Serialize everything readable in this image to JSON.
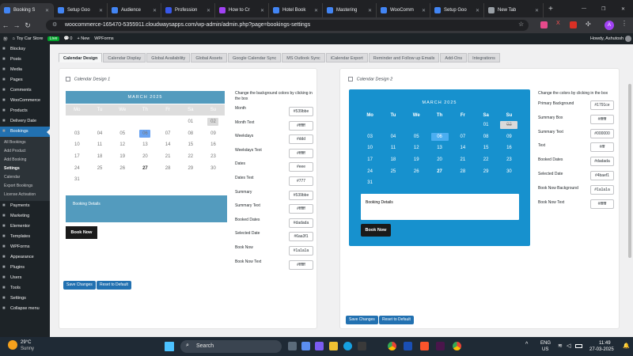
{
  "browser": {
    "tabs": [
      {
        "title": "Booking S",
        "color": "#4285f4",
        "active": true
      },
      {
        "title": "Setup Goo",
        "color": "#4285f4"
      },
      {
        "title": "Audience",
        "color": "#4285f4"
      },
      {
        "title": "Profession",
        "color": "#3858e9"
      },
      {
        "title": "How to Cr",
        "color": "#a142f4"
      },
      {
        "title": "Hotel Book",
        "color": "#4285f4"
      },
      {
        "title": "Mastering",
        "color": "#4285f4"
      },
      {
        "title": "WooComm",
        "color": "#4285f4"
      },
      {
        "title": "Setup Goo",
        "color": "#4285f4"
      },
      {
        "title": "New Tab",
        "color": "#9aa0a6"
      }
    ],
    "url": "woocommerce-165470-5355911.cloudwaysapps.com/wp-admin/admin.php?page=bookings-settings",
    "profile_initial": "A"
  },
  "adminbar": {
    "site": "Toy Car Store",
    "live": "Live",
    "comments": "0",
    "new": "+ New",
    "wpforms": "WPForms",
    "howdy": "Howdy, Ashutosh"
  },
  "sidebar": {
    "items_top": [
      {
        "label": "Blocksy",
        "icon": "blocksy-icon"
      },
      {
        "label": "Posts",
        "icon": "pin-icon"
      },
      {
        "label": "Media",
        "icon": "media-icon"
      },
      {
        "label": "Pages",
        "icon": "page-icon"
      },
      {
        "label": "Comments",
        "icon": "comment-icon"
      },
      {
        "label": "WooCommerce",
        "icon": "woo-icon"
      },
      {
        "label": "Products",
        "icon": "box-icon"
      },
      {
        "label": "Delivery Date",
        "icon": "calendar-icon"
      },
      {
        "label": "Bookings",
        "icon": "calendar-icon"
      }
    ],
    "submenu": [
      "All Bookings",
      "Add Product",
      "Add Booking",
      "Settings",
      "Calendar",
      "Export Bookings",
      "License Activation"
    ],
    "items_bottom": [
      {
        "label": "Payments",
        "icon": "payments-icon"
      },
      {
        "label": "Marketing",
        "icon": "megaphone-icon"
      },
      {
        "label": "Elementor",
        "icon": "elementor-icon"
      },
      {
        "label": "Templates",
        "icon": "folder-icon"
      },
      {
        "label": "WPForms",
        "icon": "form-icon"
      },
      {
        "label": "Appearance",
        "icon": "brush-icon"
      },
      {
        "label": "Plugins",
        "icon": "plug-icon"
      },
      {
        "label": "Users",
        "icon": "user-icon"
      },
      {
        "label": "Tools",
        "icon": "wrench-icon"
      },
      {
        "label": "Settings",
        "icon": "gear-icon"
      },
      {
        "label": "Collapse menu",
        "icon": "collapse-icon"
      }
    ]
  },
  "settings_tabs": [
    "Calendar Design",
    "Calendar Display",
    "Global Availability",
    "Global Assets",
    "Google Calendar Sync",
    "MS Outlook Sync",
    "iCalendar Export",
    "Reminder and Follow up Emails",
    "Add-Ons",
    "Integrations"
  ],
  "calendar": {
    "month": "MARCH 2025",
    "weekdays": [
      "Mo",
      "Tu",
      "We",
      "Th",
      "Fr",
      "Sa",
      "Su"
    ],
    "weeks": [
      [
        "",
        "",
        "",
        "",
        "",
        "01",
        "02"
      ],
      [
        "03",
        "04",
        "05",
        "06",
        "07",
        "08",
        "09"
      ],
      [
        "10",
        "11",
        "12",
        "13",
        "14",
        "15",
        "16"
      ],
      [
        "17",
        "18",
        "19",
        "20",
        "21",
        "22",
        "23"
      ],
      [
        "24",
        "25",
        "26",
        "27",
        "28",
        "29",
        "30"
      ],
      [
        "31",
        "",
        "",
        "",
        "",
        "",
        ""
      ]
    ]
  },
  "design1": {
    "label": "Calendar Design 1",
    "header_bg": "#539bbe",
    "booking_details": "Booking Details",
    "book_now": "Book Now",
    "intro": "Change the background colors by clicking in the box",
    "settings": [
      {
        "label": "Month",
        "value": "#539bbe"
      },
      {
        "label": "Month Text",
        "value": "#ffffff"
      },
      {
        "label": "Weekdays",
        "value": "#ddd"
      },
      {
        "label": "Weekdays Text",
        "value": "#ffffff"
      },
      {
        "label": "Dates",
        "value": "#eee"
      },
      {
        "label": "Dates Text",
        "value": "#777"
      },
      {
        "label": "Summary",
        "value": "#539bbe"
      },
      {
        "label": "Summary Text",
        "value": "#ffffff"
      },
      {
        "label": "Booked Dates",
        "value": "#dadada"
      },
      {
        "label": "Selected Date",
        "value": "#6aa3f1"
      },
      {
        "label": "Book Now",
        "value": "#1a1a1a"
      },
      {
        "label": "Book Now Text",
        "value": "#ffffff"
      }
    ],
    "save": "Save Changes",
    "reset": "Reset to Default"
  },
  "design2": {
    "label": "Calendar Design 2",
    "primary_bg": "#1791ce",
    "booking_details": "Booking Details",
    "book_now": "Book Now",
    "intro": "Change the colors by clicking in the box",
    "settings": [
      {
        "label": "Primary Background",
        "value": "#1791ce"
      },
      {
        "label": "Summary Box",
        "value": "#ffffff"
      },
      {
        "label": "Summary Text",
        "value": "#000000"
      },
      {
        "label": "Text",
        "value": "#fff"
      },
      {
        "label": "Booked Dates",
        "value": "#dadada"
      },
      {
        "label": "Selected Date",
        "value": "#4baef1"
      },
      {
        "label": "Book Now Background",
        "value": "#1a1a1a"
      },
      {
        "label": "Book Now Text",
        "value": "#ffffff"
      }
    ],
    "save": "Save Changes",
    "reset": "Reset to Default"
  },
  "taskbar": {
    "temp": "29°C",
    "weather": "Sunny",
    "search": "Search",
    "lang": "ENG",
    "region": "US",
    "time": "11:49",
    "date": "27-03-2025"
  }
}
